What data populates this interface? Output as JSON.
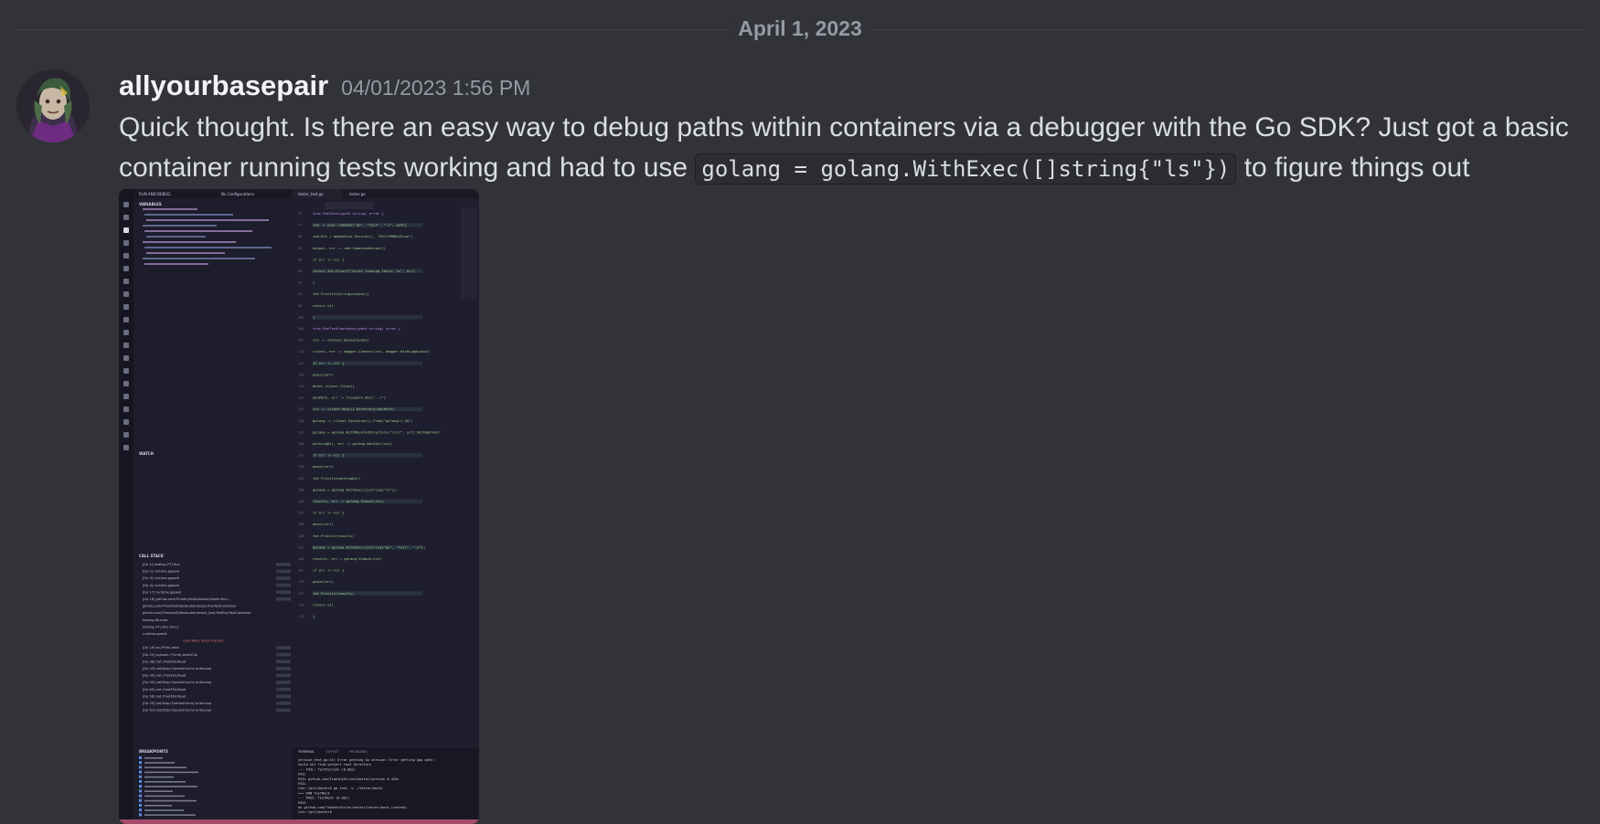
{
  "date_divider": "April 1, 2023",
  "message": {
    "author": "allyourbasepair",
    "timestamp": "04/01/2023 1:56 PM",
    "text_before": "Quick thought. Is there an easy way to debug paths within containers via a debugger with the Go SDK? Just got a basic container running tests working and had to use ",
    "code": "golang = golang.WithExec([]string{\"ls\"})",
    "text_after": " to figure things out"
  },
  "attachment": {
    "sidebar_sections": [
      "VARIABLES",
      "WATCH",
      "CALL STACK",
      "BREAKPOINTS"
    ],
    "tabs": [
      "tester_test.go",
      "tester.go"
    ],
    "panel_tabs": [
      "TERMINAL",
      "OUTPUT",
      "PROBLEMS"
    ],
    "editor_title": "RUN AND DEBUG",
    "config_label": "No Configurations",
    "code_lines": [
      "func RunTests(path string) error {",
      "  cmd := exec.Command(\"go\", \"test\", \"-v\", path)",
      "  cmd.Env = append(os.Environ(), \"GO111MODULE=on\")",
      "  output, err := cmd.CombinedOutput()",
      "  if err != nil {",
      "    return fmt.Errorf(\"error running tests: %v\", err)",
      "  }",
      "  fmt.Println(string(output))",
      "  return nil",
      "}",
      "func RunTestContainer(path string) error {",
      "  ctx := context.Background()",
      "  client, err := dagger.Connect(ctx, dagger.WithLogOutput)",
      "  if err != nil {",
      "    panic(err)",
      "  defer client.Close()",
      "  absPath, err := filepath.Abs(\"../\")",
      "  src := client.Host().Directory(absPath)",
      "  golang := client.Container().From(\"golang:1.20\")",
      "  golang = golang.WithMountedDirectory(\"/src\", src).WithWorkdir",
      "  workingDir, err := golang.Workdir(ctx)",
      "  if err != nil {",
      "    panic(err)",
      "  fmt.Println(workingDir)",
      "  golang = golang.WithExec([]string{\"ls\"})",
      "  results, err := golang.Stdout(ctx)",
      "  if err != nil {",
      "    panic(err)",
      "  fmt.Println(results)",
      "  golang = golang.WithExec([]string{\"go\", \"test\", \"-v\"})",
      "  results, err = golang.Stdout(ctx)",
      "  if err != nil {",
      "    panic(err)",
      "  fmt.Println(results)",
      "  return nil",
      "}"
    ],
    "call_stack": [
      "[Go 1] testing.(*T).Run",
      "[Go 2] runtime.gopark",
      "[Go 3] runtime.gopark",
      "[Go 4] runtime.gopark",
      "[Go 17] runtime.gopark",
      "[Go 18] github.com/TimothyStiles/buster/tester.Run...",
      "github.com/TimothyStiles/buster/tester.RunTestContainer",
      "github.com/TimothyStiles/buster/tester_test.TestRunTestContainer",
      "testing.tRunner",
      "testing.(*T).Run.func1",
      "runtime.goexit",
      "Load More Stack Frames",
      "[Go 19] os.(*File).read",
      "[Go 20] os/exec.(*Cmd).watchCtx",
      "[Go 38] net.(*netFD).Read",
      "[Go 43] net/http.(*persistConn).writeLoop",
      "[Go 49] net.(*netFD).Read",
      "[Go 50] net/http.(*persistConn).writeLoop",
      "[Go 60] net.(*netFD).Read",
      "[Go 58] net.(*netFD).Read",
      "[Go 59] net/http.(*persistConn).writeLoop",
      "[Go 61] net/http.(*persistConn).writeLoop"
    ],
    "terminal_lines": [
      "version_test.go:15: Error getting Go version: Error getting app path:",
      "Could not find project root directory",
      "--- FAIL: TestVersion (0.00s)",
      "FAIL",
      "FAIL   github.com/TimothyStiles/buster/version 0.434s",
      "FAIL",
      "tim:~/git/buster$ go test -v ./tester/mock/",
      "=== RUN   TestMock",
      "--- PASS: TestMock (0.00s)",
      "PASS",
      "ok     github.com/TimothyStiles/buster/tester/mock    (cached)",
      "tim:~/git/buster$"
    ]
  },
  "colors": {
    "background": "#313338",
    "username": "#f2f3f5",
    "muted": "#949ba4",
    "text": "#dbdee1"
  }
}
